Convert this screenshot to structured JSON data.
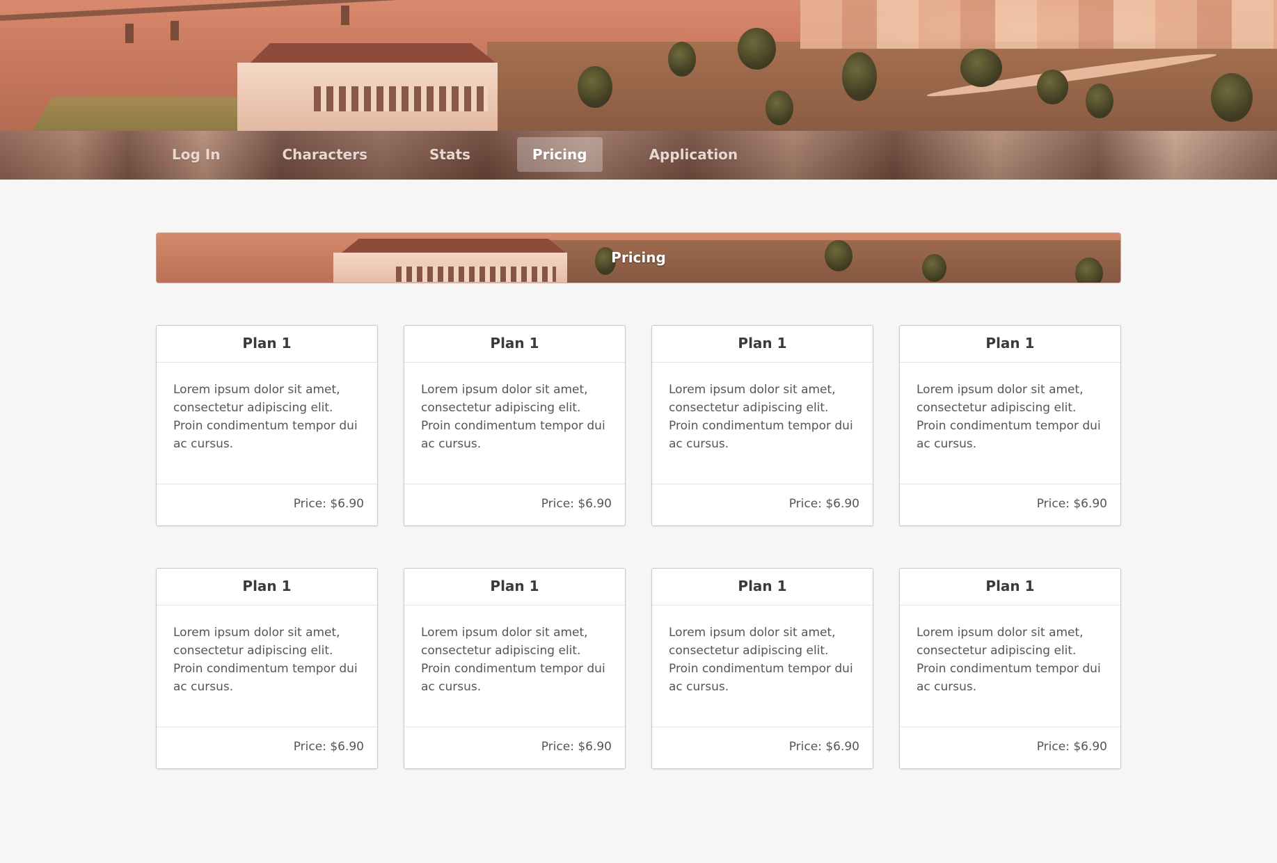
{
  "nav": {
    "items": [
      {
        "label": "Log In",
        "active": false
      },
      {
        "label": "Characters",
        "active": false
      },
      {
        "label": "Stats",
        "active": false
      },
      {
        "label": "Pricing",
        "active": true
      },
      {
        "label": "Application",
        "active": false
      }
    ]
  },
  "page": {
    "title": "Pricing"
  },
  "plans": [
    {
      "title": "Plan 1",
      "description": "Lorem ipsum dolor sit amet, consectetur adipiscing elit. Proin condimentum tempor dui ac cursus.",
      "price": "Price: $6.90"
    },
    {
      "title": "Plan 1",
      "description": "Lorem ipsum dolor sit amet, consectetur adipiscing elit. Proin condimentum tempor dui ac cursus.",
      "price": "Price: $6.90"
    },
    {
      "title": "Plan 1",
      "description": "Lorem ipsum dolor sit amet, consectetur adipiscing elit. Proin condimentum tempor dui ac cursus.",
      "price": "Price: $6.90"
    },
    {
      "title": "Plan 1",
      "description": "Lorem ipsum dolor sit amet, consectetur adipiscing elit. Proin condimentum tempor dui ac cursus.",
      "price": "Price: $6.90"
    },
    {
      "title": "Plan 1",
      "description": "Lorem ipsum dolor sit amet, consectetur adipiscing elit. Proin condimentum tempor dui ac cursus.",
      "price": "Price: $6.90"
    },
    {
      "title": "Plan 1",
      "description": "Lorem ipsum dolor sit amet, consectetur adipiscing elit. Proin condimentum tempor dui ac cursus.",
      "price": "Price: $6.90"
    },
    {
      "title": "Plan 1",
      "description": "Lorem ipsum dolor sit amet, consectetur adipiscing elit. Proin condimentum tempor dui ac cursus.",
      "price": "Price: $6.90"
    },
    {
      "title": "Plan 1",
      "description": "Lorem ipsum dolor sit amet, consectetur adipiscing elit. Proin condimentum tempor dui ac cursus.",
      "price": "Price: $6.90"
    }
  ],
  "colors": {
    "background": "#f6f6f6",
    "header_tint": "#d98a6e",
    "card_border": "#c8c8c8",
    "text_heading": "#3a3a3a",
    "text_body": "#555555"
  }
}
